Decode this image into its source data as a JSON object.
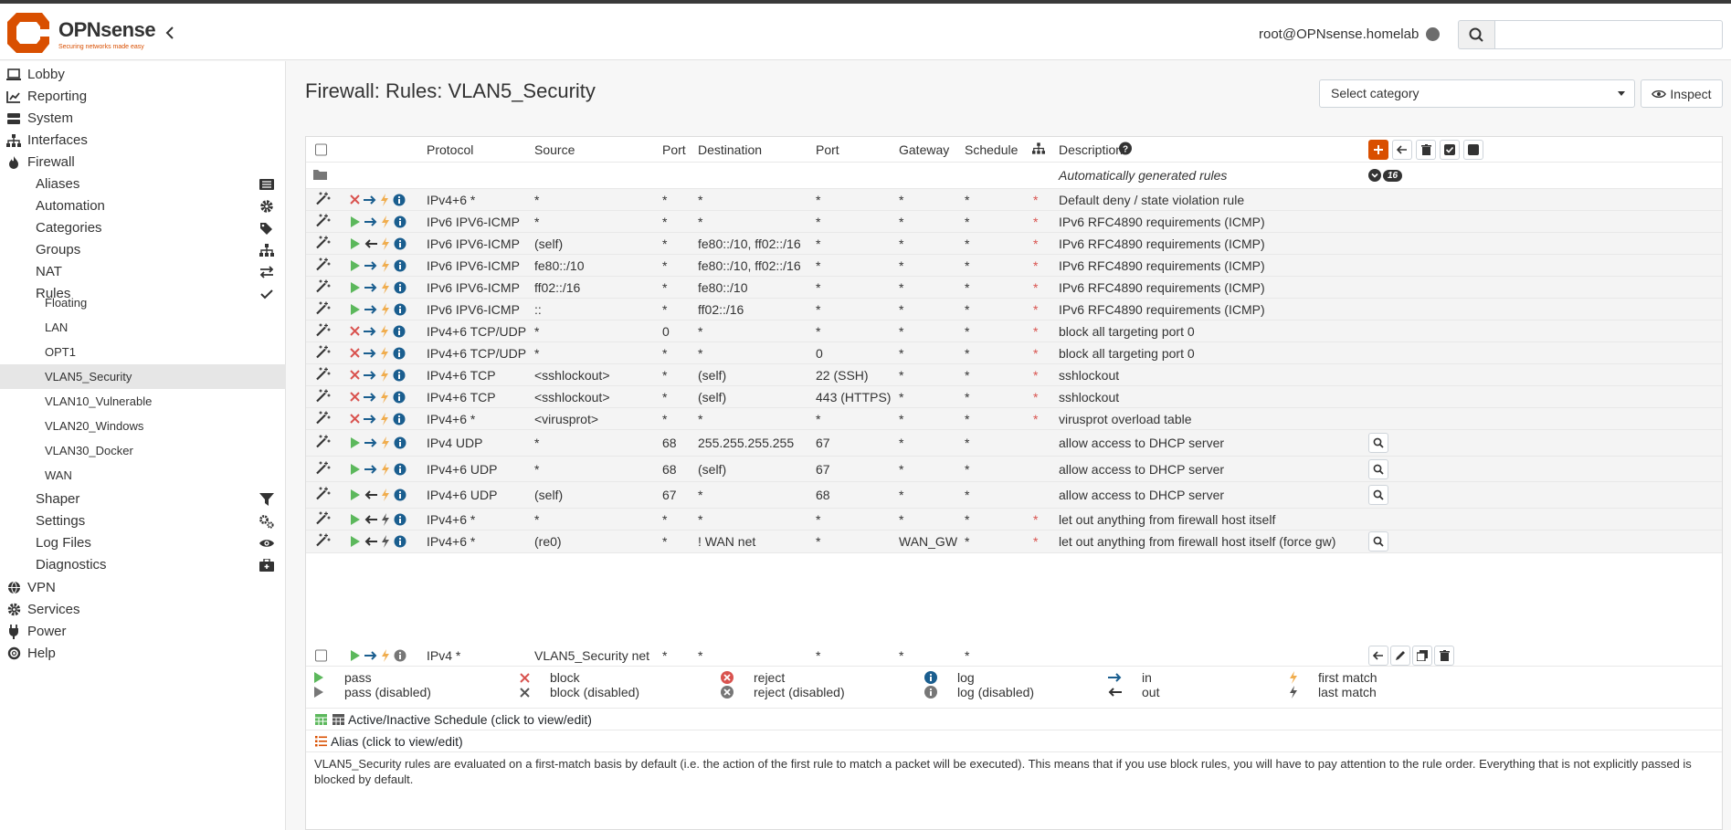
{
  "header": {
    "logo_text": "OPNsense",
    "logo_tagline": "Securing networks made easy",
    "user": "root@OPNsense.homelab",
    "search_placeholder": ""
  },
  "sidebar": {
    "items": [
      {
        "label": "Lobby",
        "icon": "laptop-icon"
      },
      {
        "label": "Reporting",
        "icon": "chart-icon"
      },
      {
        "label": "System",
        "icon": "server-icon"
      },
      {
        "label": "Interfaces",
        "icon": "sitemap-icon"
      },
      {
        "label": "Firewall",
        "icon": "fire-icon"
      }
    ],
    "firewall_sub": [
      {
        "label": "Aliases",
        "icon": "list-icon"
      },
      {
        "label": "Automation",
        "icon": "gear-icon"
      },
      {
        "label": "Categories",
        "icon": "tags-icon"
      },
      {
        "label": "Groups",
        "icon": "sitemap-icon"
      },
      {
        "label": "NAT",
        "icon": "exchange-icon"
      },
      {
        "label": "Rules",
        "icon": "check-icon"
      }
    ],
    "rules_sub": [
      "Floating",
      "LAN",
      "OPT1",
      "VLAN5_Security",
      "VLAN10_Vulnerable",
      "VLAN20_Windows",
      "VLAN30_Docker",
      "WAN"
    ],
    "firewall_sub2": [
      {
        "label": "Shaper",
        "icon": "filter-icon"
      },
      {
        "label": "Settings",
        "icon": "gears-icon"
      },
      {
        "label": "Log Files",
        "icon": "eye-icon"
      },
      {
        "label": "Diagnostics",
        "icon": "medkit-icon"
      }
    ],
    "bottom": [
      {
        "label": "VPN",
        "icon": "globe-icon"
      },
      {
        "label": "Services",
        "icon": "cog-icon"
      },
      {
        "label": "Power",
        "icon": "plug-icon"
      },
      {
        "label": "Help",
        "icon": "lifering-icon"
      }
    ]
  },
  "page": {
    "title": "Firewall: Rules: VLAN5_Security",
    "category_select": "Select category",
    "inspect": "Inspect"
  },
  "table": {
    "headers": {
      "protocol": "Protocol",
      "source": "Source",
      "port": "Port",
      "destination": "Destination",
      "dport": "Port",
      "gateway": "Gateway",
      "schedule": "Schedule",
      "description": "Description"
    },
    "auto_group_label": "Automatically generated rules",
    "auto_group_count": "16",
    "rules": [
      {
        "action": "block",
        "dir": "in",
        "proto": "IPv4+6 *",
        "src": "*",
        "sport": "*",
        "dst": "*",
        "dport": "*",
        "gw": "*",
        "sched": "*",
        "star": "*",
        "desc": "Default deny / state violation rule",
        "inspect": false
      },
      {
        "action": "pass",
        "dir": "in",
        "proto": "IPv6 IPV6-ICMP",
        "src": "*",
        "sport": "*",
        "dst": "*",
        "dport": "*",
        "gw": "*",
        "sched": "*",
        "star": "*",
        "desc": "IPv6 RFC4890 requirements (ICMP)",
        "inspect": false
      },
      {
        "action": "pass",
        "dir": "out",
        "proto": "IPv6 IPV6-ICMP",
        "src": "(self)",
        "sport": "*",
        "dst": "fe80::/10, ff02::/16",
        "dport": "*",
        "gw": "*",
        "sched": "*",
        "star": "*",
        "desc": "IPv6 RFC4890 requirements (ICMP)",
        "inspect": false
      },
      {
        "action": "pass",
        "dir": "in",
        "proto": "IPv6 IPV6-ICMP",
        "src": "fe80::/10",
        "sport": "*",
        "dst": "fe80::/10, ff02::/16",
        "dport": "*",
        "gw": "*",
        "sched": "*",
        "star": "*",
        "desc": "IPv6 RFC4890 requirements (ICMP)",
        "inspect": false
      },
      {
        "action": "pass",
        "dir": "in",
        "proto": "IPv6 IPV6-ICMP",
        "src": "ff02::/16",
        "sport": "*",
        "dst": "fe80::/10",
        "dport": "*",
        "gw": "*",
        "sched": "*",
        "star": "*",
        "desc": "IPv6 RFC4890 requirements (ICMP)",
        "inspect": false
      },
      {
        "action": "pass",
        "dir": "in",
        "proto": "IPv6 IPV6-ICMP",
        "src": "::",
        "sport": "*",
        "dst": "ff02::/16",
        "dport": "*",
        "gw": "*",
        "sched": "*",
        "star": "*",
        "desc": "IPv6 RFC4890 requirements (ICMP)",
        "inspect": false
      },
      {
        "action": "block",
        "dir": "in",
        "proto": "IPv4+6 TCP/UDP",
        "src": "*",
        "sport": "0",
        "dst": "*",
        "dport": "*",
        "gw": "*",
        "sched": "*",
        "star": "*",
        "desc": "block all targeting port 0",
        "inspect": false
      },
      {
        "action": "block",
        "dir": "in",
        "proto": "IPv4+6 TCP/UDP",
        "src": "*",
        "sport": "*",
        "dst": "*",
        "dport": "0",
        "gw": "*",
        "sched": "*",
        "star": "*",
        "desc": "block all targeting port 0",
        "inspect": false
      },
      {
        "action": "block",
        "dir": "in",
        "proto": "IPv4+6 TCP",
        "src": "<sshlockout>",
        "sport": "*",
        "dst": "(self)",
        "dport": "22 (SSH)",
        "gw": "*",
        "sched": "*",
        "star": "*",
        "desc": "sshlockout",
        "inspect": false
      },
      {
        "action": "block",
        "dir": "in",
        "proto": "IPv4+6 TCP",
        "src": "<sshlockout>",
        "sport": "*",
        "dst": "(self)",
        "dport": "443 (HTTPS)",
        "gw": "*",
        "sched": "*",
        "star": "*",
        "desc": "sshlockout",
        "inspect": false
      },
      {
        "action": "block",
        "dir": "in",
        "proto": "IPv4+6 *",
        "src": "<virusprot>",
        "sport": "*",
        "dst": "*",
        "dport": "*",
        "gw": "*",
        "sched": "*",
        "star": "*",
        "desc": "virusprot overload table",
        "inspect": false
      },
      {
        "action": "pass",
        "dir": "in",
        "proto": "IPv4 UDP",
        "src": "*",
        "sport": "68",
        "dst": "255.255.255.255",
        "dport": "67",
        "gw": "*",
        "sched": "*",
        "star": "",
        "desc": "allow access to DHCP server",
        "inspect": true
      },
      {
        "action": "pass",
        "dir": "in",
        "proto": "IPv4+6 UDP",
        "src": "*",
        "sport": "68",
        "dst": "(self)",
        "dport": "67",
        "gw": "*",
        "sched": "*",
        "star": "",
        "desc": "allow access to DHCP server",
        "inspect": true
      },
      {
        "action": "pass",
        "dir": "out",
        "proto": "IPv4+6 UDP",
        "src": "(self)",
        "sport": "67",
        "dst": "*",
        "dport": "68",
        "gw": "*",
        "sched": "*",
        "star": "",
        "desc": "allow access to DHCP server",
        "inspect": true
      },
      {
        "action": "pass",
        "dir": "out",
        "proto": "IPv4+6 *",
        "src": "*",
        "sport": "*",
        "dst": "*",
        "dport": "*",
        "gw": "*",
        "sched": "*",
        "star": "*",
        "desc": "let out anything from firewall host itself",
        "inspect": false
      },
      {
        "action": "pass",
        "dir": "out",
        "proto": "IPv4+6 *",
        "src": "(re0)",
        "sport": "*",
        "dst": "! WAN net",
        "dport": "*",
        "gw": "WAN_GW",
        "sched": "*",
        "star": "*",
        "desc": "let out anything from firewall host itself (force gw)",
        "inspect": true
      }
    ],
    "user_rule": {
      "proto": "IPv4 *",
      "src": "VLAN5_Security net",
      "sport": "*",
      "dst": "*",
      "dport": "*",
      "gw": "*",
      "sched": "*"
    }
  },
  "legend": {
    "pass": "pass",
    "pass_disabled": "pass (disabled)",
    "block": "block",
    "block_disabled": "block (disabled)",
    "reject": "reject",
    "reject_disabled": "reject (disabled)",
    "log": "log",
    "log_disabled": "log (disabled)",
    "in": "in",
    "out": "out",
    "first_match": "first match",
    "last_match": "last match",
    "schedule": "Active/Inactive Schedule (click to view/edit)",
    "alias": "Alias (click to view/edit)"
  },
  "footer": "VLAN5_Security rules are evaluated on a first-match basis by default (i.e. the action of the first rule to match a packet will be executed). This means that if you use block rules, you will have to pay attention to the rule order. Everything that is not explicitly passed is blocked by default.",
  "colors": {
    "accent": "#d94f00",
    "pass": "#5cb85c",
    "block": "#d9534f",
    "info": "#1a5e8f",
    "lightning": "#f0ad4e"
  }
}
